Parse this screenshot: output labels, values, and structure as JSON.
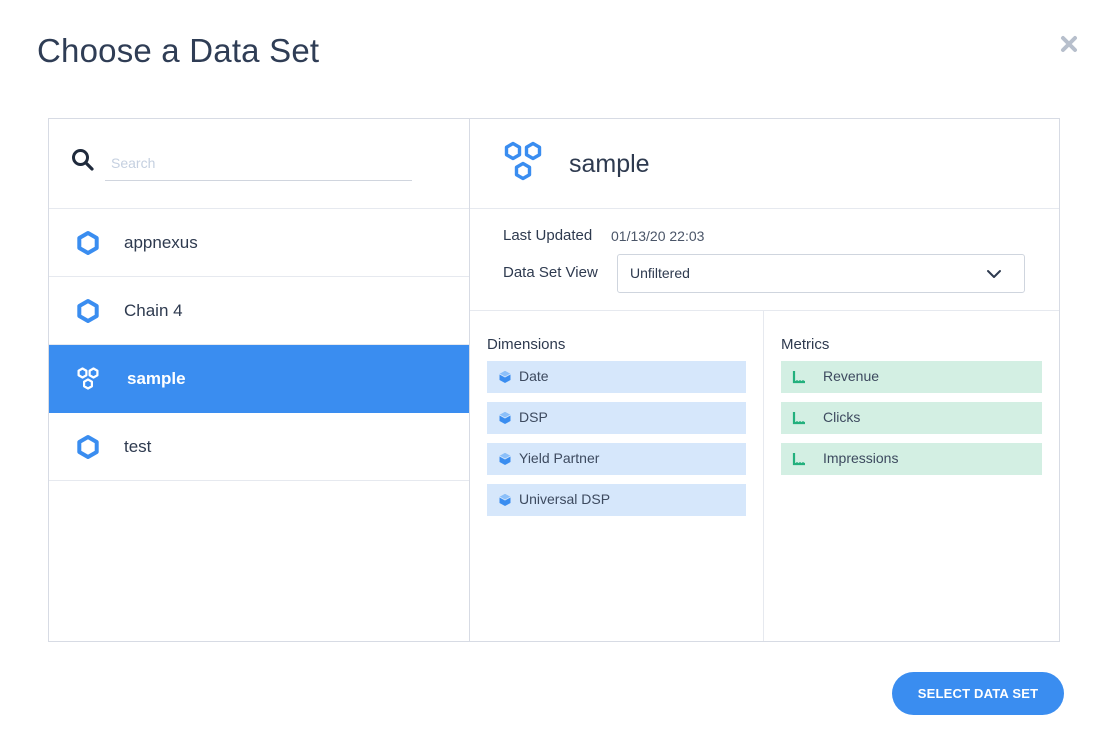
{
  "dialog": {
    "title": "Choose a Data Set",
    "close_icon": "close-x-icon",
    "primary_button": "SELECT DATA SET"
  },
  "colors": {
    "accent": "#3a8df0",
    "dimension_chip": "#d6e7fb",
    "metric_chip": "#d3efe3",
    "metric_icon": "#22b07d",
    "text": "#2e3a4f"
  },
  "search": {
    "placeholder": "Search",
    "value": ""
  },
  "datasets": [
    {
      "label": "appnexus",
      "icon": "hexagon-icon",
      "selected": false
    },
    {
      "label": "Chain 4",
      "icon": "hexagon-icon",
      "selected": false
    },
    {
      "label": "sample",
      "icon": "hexagon-cluster-icon",
      "selected": true
    },
    {
      "label": "test",
      "icon": "hexagon-icon",
      "selected": false
    }
  ],
  "detail": {
    "name": "sample",
    "icon": "hexagon-cluster-icon",
    "last_updated_label": "Last Updated",
    "last_updated_value": "01/13/20 22:03",
    "view_label": "Data Set View",
    "view_value": "Unfiltered",
    "dimensions_title": "Dimensions",
    "metrics_title": "Metrics",
    "dimensions": [
      "Date",
      "DSP",
      "Yield Partner",
      "Universal DSP"
    ],
    "metrics": [
      "Revenue",
      "Clicks",
      "Impressions"
    ]
  }
}
